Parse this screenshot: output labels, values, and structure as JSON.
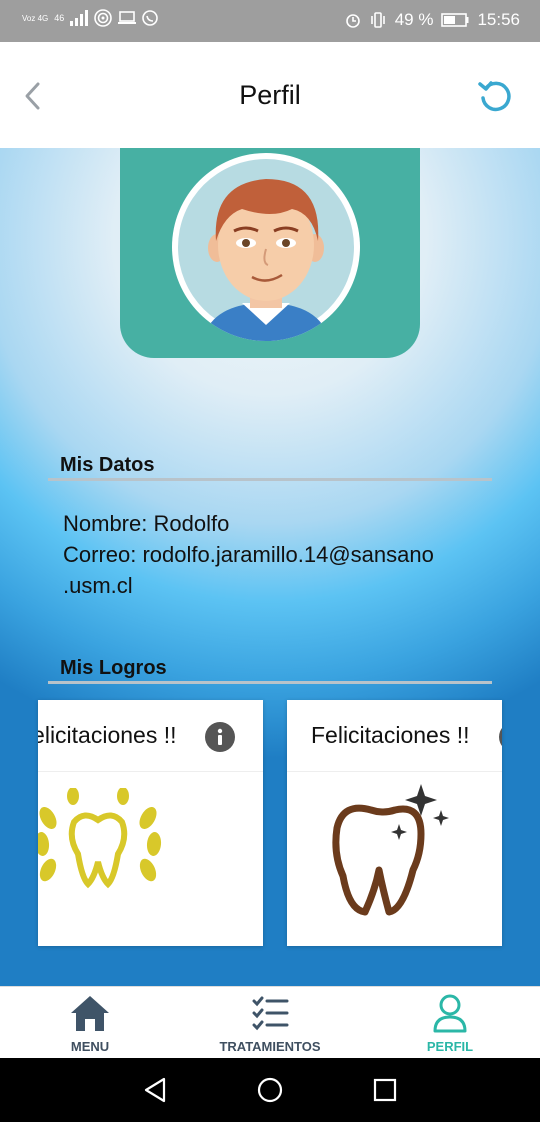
{
  "status_bar": {
    "carrier_top": "Voz 4G",
    "network": "46",
    "battery": "49 %",
    "time": "15:56"
  },
  "header": {
    "title": "Perfil"
  },
  "sections": {
    "datos_title": "Mis Datos",
    "logros_title": "Mis Logros"
  },
  "user": {
    "name_line": "Nombre: Rodolfo",
    "email_line_1": "Correo: rodolfo.jaramillo.14@sansano",
    "email_line_2": ".usm.cl"
  },
  "achievements": [
    {
      "title": "Felicitaciones !!",
      "icon": "gold-wreath-tooth-icon"
    },
    {
      "title": "Felicitaciones !!",
      "icon": "sparkling-tooth-icon"
    }
  ],
  "bottom_nav": [
    {
      "label": "MENU",
      "icon": "home-icon",
      "active": false
    },
    {
      "label": "TRATAMIENTOS",
      "icon": "checklist-icon",
      "active": false
    },
    {
      "label": "PERFIL",
      "icon": "user-icon",
      "active": true
    }
  ],
  "colors": {
    "accent": "#2bb7a7",
    "avatar_bg": "#47b0a3",
    "refresh": "#3aa8d0"
  }
}
